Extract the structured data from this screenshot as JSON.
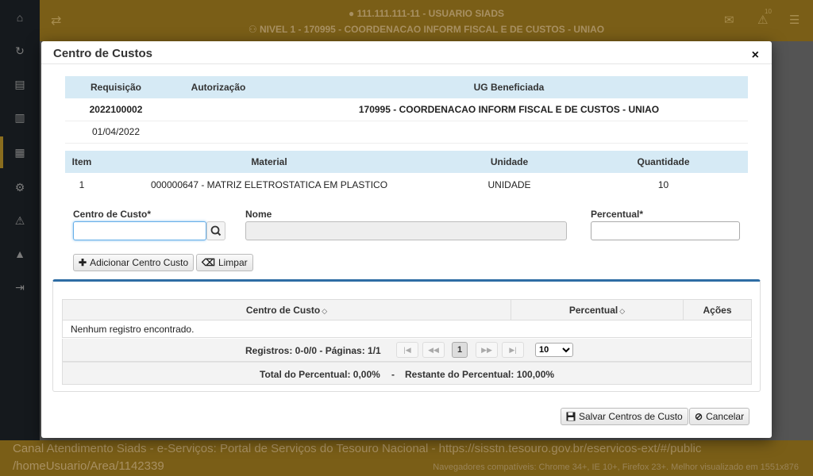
{
  "header": {
    "user_line": "111.111.111-11 - USUARIO SIADS",
    "level_line": "NIVEL 1 - 170995 - COORDENACAO INFORM FISCAL E DE CUSTOS - UNIAO",
    "notification_count": "10"
  },
  "footer": {
    "line1": "Canal Atendimento Siads - e-Serviços: Portal de Serviços do Tesouro Nacional - https://sisstn.tesouro.gov.br/eservicos-ext/#/public",
    "line2": "/homeUsuario/Area/1142339",
    "browsers": "Navegadores compatíveis: Chrome 34+, IE 10+, Firefox 23+. Melhor visualizado em 1551x876"
  },
  "modal": {
    "title": "Centro de Custos",
    "close_symbol": "×"
  },
  "requisition": {
    "headers": [
      "Requisição",
      "Autorização",
      "UG Beneficiada"
    ],
    "number": "2022100002",
    "date": "01/04/2022",
    "authorization": "",
    "ug": "170995 - COORDENACAO INFORM FISCAL E DE CUSTOS - UNIAO"
  },
  "item": {
    "headers": [
      "Item",
      "Material",
      "Unidade",
      "Quantidade"
    ],
    "row": [
      "1",
      "000000647 - MATRIZ ELETROSTATICA EM PLASTICO",
      "UNIDADE",
      "10"
    ]
  },
  "form": {
    "centro_label": "Centro de Custo*",
    "centro_value": "",
    "nome_label": "Nome",
    "nome_value": "",
    "percentual_label": "Percentual*",
    "percentual_value": "",
    "add_label": "Adicionar Centro Custo",
    "clear_label": "Limpar"
  },
  "grid": {
    "headers": [
      "Centro de Custo",
      "Percentual",
      "Ações"
    ],
    "empty_message": "Nenhum registro encontrado.",
    "records_info": "Registros: 0-0/0 - Páginas: 1/1",
    "current_page": "1",
    "page_size": "10",
    "total_label": "Total do Percentual: 0,00%",
    "separator": "-",
    "remaining_label": "Restante do Percentual: 100,00%"
  },
  "actions": {
    "save_label": "Salvar Centros de Custo",
    "cancel_label": "Cancelar"
  }
}
